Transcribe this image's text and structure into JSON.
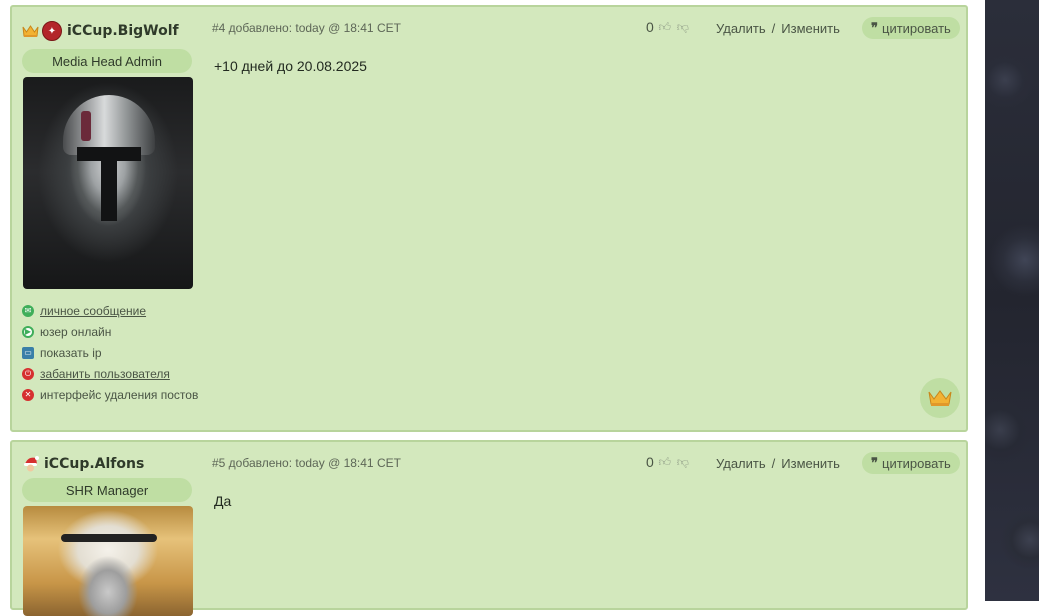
{
  "posts": [
    {
      "username": "iCCup.BigWolf",
      "role": "Media Head Admin",
      "meta": "#4 добавлено: today @ 18:41 CET",
      "votes": "0",
      "delete": "Удалить",
      "edit": "Изменить",
      "separator": "/",
      "quote": "цитировать",
      "text": "+10 дней до 20.08.2025",
      "actions": [
        {
          "label": "личное сообщение",
          "icon": "message-icon",
          "color": "#3fae5a"
        },
        {
          "label": "юзер онлайн",
          "icon": "online-icon",
          "color": "#3fae5a"
        },
        {
          "label": "показать ip",
          "icon": "monitor-icon",
          "color": "#3a7fa8"
        },
        {
          "label": "забанить пользователя",
          "icon": "power-icon",
          "color": "#d6302f"
        },
        {
          "label": "интерфейс удаления постов",
          "icon": "delete-icon",
          "color": "#d6302f"
        }
      ]
    },
    {
      "username": "iCCup.Alfons",
      "role": "SHR Manager",
      "meta": "#5 добавлено: today @ 18:41 CET",
      "votes": "0",
      "delete": "Удалить",
      "edit": "Изменить",
      "separator": "/",
      "quote": "цитировать",
      "text": "Да"
    }
  ],
  "colors": {
    "post_bg": "#d3e8bd",
    "post_border": "#b8d49c",
    "badge_bg": "#bfdea3"
  }
}
